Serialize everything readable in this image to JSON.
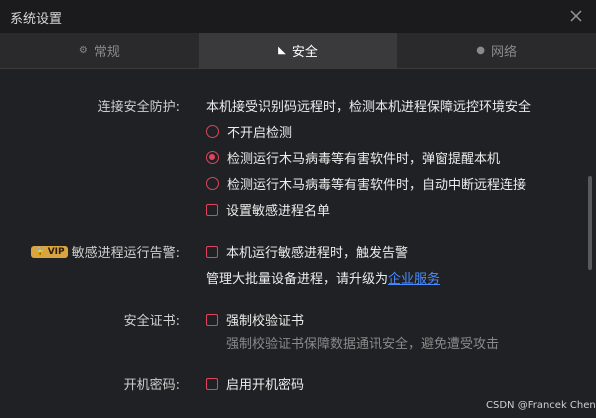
{
  "window": {
    "title": "系统设置"
  },
  "tabs": [
    {
      "label": "常规",
      "icon": "gear-icon"
    },
    {
      "label": "安全",
      "icon": "shield-icon"
    },
    {
      "label": "网络",
      "icon": "globe-icon"
    }
  ],
  "connection_protection": {
    "label": "连接安全防护:",
    "description": "本机接受识别码远程时，检测本机进程保障远控环境安全",
    "options": [
      "不开启检测",
      "检测运行木马病毒等有害软件时，弹窗提醒本机",
      "检测运行木马病毒等有害软件时，自动中断远程连接"
    ],
    "selected_index": 1,
    "sensitive_process_list": "设置敏感进程名单"
  },
  "sensitive_alert": {
    "badge": "VIP",
    "label": "敏感进程运行告警:",
    "checkbox_label": "本机运行敏感进程时，触发告警",
    "upgrade_text": "管理大批量设备进程，请升级为",
    "upgrade_link": "企业服务"
  },
  "certificate": {
    "label": "安全证书:",
    "checkbox_label": "强制校验证书",
    "hint": "强制校验证书保障数据通讯安全，避免遭受攻击"
  },
  "boot_password": {
    "label": "开机密码:",
    "checkbox_label": "启用开机密码"
  },
  "watermark": "CSDN @Francek Chen",
  "colors": {
    "accent": "#e0445c",
    "background": "#202124",
    "link": "#4a8cff",
    "vip": "#d9a441"
  }
}
